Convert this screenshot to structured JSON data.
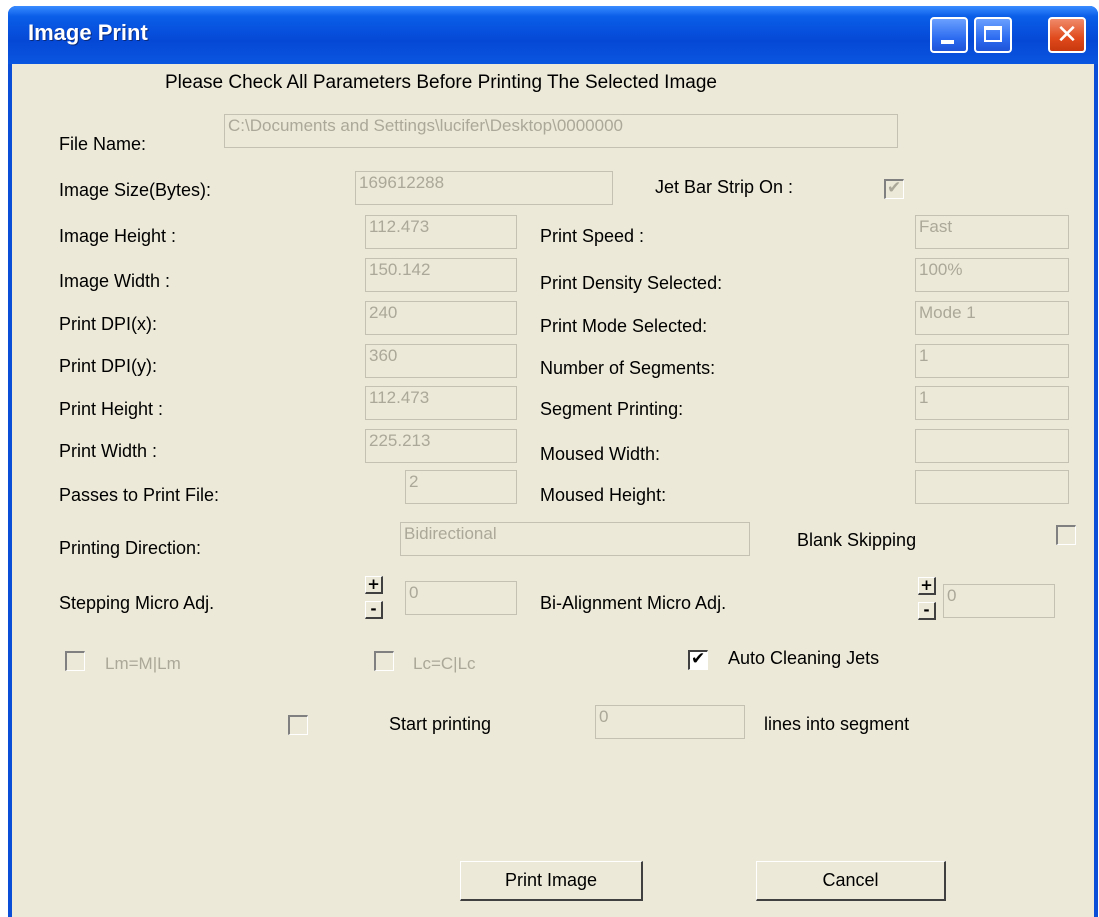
{
  "window": {
    "title": "Image Print"
  },
  "header": {
    "instruction": "Please Check All Parameters Before Printing The Selected Image"
  },
  "fields": {
    "file_name": {
      "label": "File Name:",
      "value": "C:\\Documents and Settings\\lucifer\\Desktop\\0000000"
    },
    "image_size": {
      "label": "Image Size(Bytes):",
      "value": "169612288"
    },
    "jet_bar_strip": {
      "label": "Jet Bar Strip On :",
      "checked": true
    },
    "image_height": {
      "label": "Image Height :",
      "value": "112.473"
    },
    "image_width": {
      "label": "Image Width :",
      "value": "150.142"
    },
    "print_dpi_x": {
      "label": "Print DPI(x):",
      "value": "240"
    },
    "print_dpi_y": {
      "label": "Print DPI(y):",
      "value": "360"
    },
    "print_height": {
      "label": "Print Height :",
      "value": "112.473"
    },
    "print_width": {
      "label": "Print Width :",
      "value": "225.213"
    },
    "passes": {
      "label": "Passes to Print File:",
      "value": "2"
    },
    "print_speed": {
      "label": "Print Speed :",
      "value": "Fast"
    },
    "print_density": {
      "label": "Print Density Selected:",
      "value": "100%"
    },
    "print_mode": {
      "label": "Print Mode Selected:",
      "value": "Mode 1"
    },
    "num_segments": {
      "label": "Number of Segments:",
      "value": "1"
    },
    "segment_printing": {
      "label": "Segment Printing:",
      "value": "1"
    },
    "moused_width": {
      "label": "Moused Width:",
      "value": ""
    },
    "moused_height": {
      "label": "Moused Height:",
      "value": ""
    },
    "printing_direction": {
      "label": "Printing Direction:",
      "value": "Bidirectional"
    },
    "blank_skipping": {
      "label": "Blank Skipping",
      "checked": false
    },
    "stepping_micro": {
      "label": "Stepping Micro Adj.",
      "value": "0"
    },
    "bi_alignment_micro": {
      "label": "Bi-Alignment Micro Adj.",
      "value": "0"
    }
  },
  "spin": {
    "plus": "+",
    "minus": "-"
  },
  "options": {
    "lm": {
      "label": "Lm=M|Lm",
      "checked": false
    },
    "lc": {
      "label": "Lc=C|Lc",
      "checked": false
    },
    "auto_cleaning": {
      "label": "Auto Cleaning Jets",
      "checked": true
    },
    "start_printing": {
      "label": "Start printing",
      "checked": false,
      "value": "0",
      "suffix": "lines into segment"
    }
  },
  "buttons": {
    "print": "Print Image",
    "cancel": "Cancel"
  },
  "glyphs": {
    "check": "✔",
    "close": "✕"
  }
}
